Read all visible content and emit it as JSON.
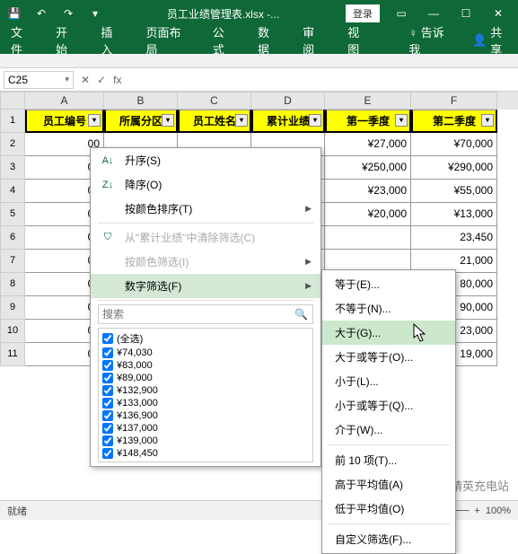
{
  "titlebar": {
    "filename": "员工业绩管理表.xlsx -...",
    "login": "登录"
  },
  "ribbon": {
    "tabs": [
      "文件",
      "开始",
      "插入",
      "页面布局",
      "公式",
      "数据",
      "审阅",
      "视图"
    ],
    "tellme": "告诉我",
    "share": "共享"
  },
  "namebox": "C25",
  "fx": "fx",
  "columns": [
    "A",
    "B",
    "C",
    "D",
    "E",
    "F"
  ],
  "headers": {
    "A": "员工编号",
    "B": "所属分区",
    "C": "员工姓名",
    "D": "累计业绩",
    "E": "第一季度",
    "F": "第二季度"
  },
  "rows": [
    {
      "n": "2",
      "A": "00",
      "E": "¥27,000",
      "F": "¥70,000"
    },
    {
      "n": "3",
      "A": "00",
      "E": "¥250,000",
      "F": "¥290,000"
    },
    {
      "n": "4",
      "A": "00",
      "E": "¥23,000",
      "F": "¥55,000"
    },
    {
      "n": "5",
      "A": "00",
      "E": "¥20,000",
      "F": "¥13,000"
    },
    {
      "n": "6",
      "A": "00",
      "E": "",
      "F": "23,450"
    },
    {
      "n": "7",
      "A": "00",
      "E": "",
      "F": "21,000"
    },
    {
      "n": "8",
      "A": "00",
      "E": "",
      "F": "80,000"
    },
    {
      "n": "9",
      "A": "00",
      "E": "",
      "F": "90,000"
    },
    {
      "n": "10",
      "A": "00",
      "E": "",
      "F": "23,000"
    },
    {
      "n": "11",
      "A": "00",
      "E": "",
      "F": "19,000"
    }
  ],
  "filter_menu": {
    "sort_asc": "升序(S)",
    "sort_desc": "降序(O)",
    "sort_color": "按颜色排序(T)",
    "clear": "从\"累计业绩\"中清除筛选(C)",
    "filter_color": "按颜色筛选(I)",
    "number_filter": "数字筛选(F)",
    "search_placeholder": "搜索",
    "select_all": "(全选)",
    "values": [
      "¥74,030",
      "¥83,000",
      "¥89,000",
      "¥132,900",
      "¥133,000",
      "¥136,900",
      "¥137,000",
      "¥139,000",
      "¥148,450"
    ]
  },
  "sub_menu": {
    "items1": [
      "等于(E)...",
      "不等于(N)...",
      "大于(G)...",
      "大于或等于(O)...",
      "小于(L)...",
      "小于或等于(Q)...",
      "介于(W)..."
    ],
    "items2": [
      "前 10 项(T)...",
      "高于平均值(A)",
      "低于平均值(O)"
    ],
    "items3": [
      "自定义筛选(F)..."
    ],
    "highlight_index": 2
  },
  "statusbar": {
    "ready": "就绪",
    "zoom": "100%"
  },
  "watermark": "新精英充电站"
}
